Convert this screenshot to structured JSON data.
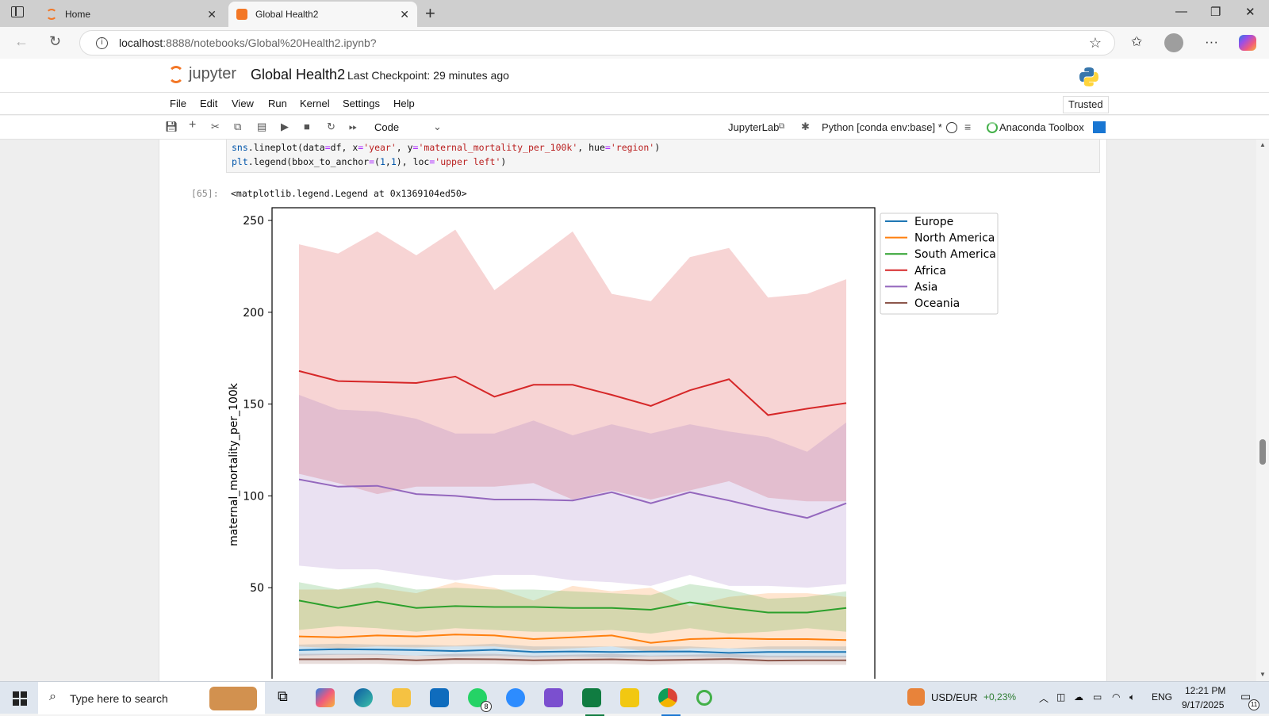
{
  "browser": {
    "tabs": [
      {
        "title": "Home",
        "active": false
      },
      {
        "title": "Global Health2",
        "active": true
      }
    ],
    "url_host": "localhost",
    "url_rest": ":8888/notebooks/Global%20Health2.ipynb?"
  },
  "jupyter": {
    "logo_text": "jupyter",
    "notebook_title": "Global Health2",
    "checkpoint": "Last Checkpoint: 29 minutes ago",
    "menu": [
      "File",
      "Edit",
      "View",
      "Run",
      "Kernel",
      "Settings",
      "Help"
    ],
    "trusted": "Trusted",
    "cell_type": "Code",
    "jupyterlab_link": "JupyterLab",
    "kernel": "Python [conda env:base] *",
    "anaconda": "Anaconda Toolbox"
  },
  "cell": {
    "code_lines": [
      "sns.lineplot(data=df, x='year', y='maternal_mortality_per_100k', hue='region')",
      "plt.legend(bbox_to_anchor=(1,1), loc='upper left')"
    ],
    "out_prompt": "[65]:",
    "output_text": "<matplotlib.legend.Legend at 0x1369104ed50>"
  },
  "chart_data": {
    "type": "line",
    "xlabel": "",
    "ylabel": "maternal_mortality_per_100k",
    "yticks": [
      50,
      100,
      150,
      200,
      250
    ],
    "ylim": [
      10,
      255
    ],
    "x": [
      0,
      1,
      2,
      3,
      4,
      5,
      6,
      7,
      8,
      9,
      10,
      11,
      12,
      13,
      14
    ],
    "legend_position": "upper-left outside right",
    "series": [
      {
        "name": "Europe",
        "color": "#1f77b4",
        "values": [
          16,
          16.5,
          16.3,
          16,
          15.5,
          16.2,
          15,
          15.3,
          15,
          15.2,
          15.3,
          14.5,
          15,
          15,
          15
        ],
        "ci_low": [
          13,
          13.5,
          13.5,
          13,
          12.5,
          13,
          12,
          12.5,
          12,
          12.5,
          12.5,
          12,
          12,
          12,
          12
        ],
        "ci_high": [
          19,
          19.5,
          19,
          19,
          18.5,
          19.5,
          18,
          18,
          18,
          18,
          18,
          17,
          18,
          18,
          18
        ]
      },
      {
        "name": "North America",
        "color": "#ff7f0e",
        "values": [
          23.5,
          23,
          24,
          23.5,
          24.5,
          24,
          22,
          23,
          24,
          20,
          22,
          22.5,
          22,
          22,
          21.5
        ],
        "ci_low": [
          18,
          17,
          18,
          17.5,
          18,
          18,
          16,
          17,
          18,
          15,
          17,
          17,
          16.5,
          16.5,
          16
        ],
        "ci_high": [
          49,
          49,
          50,
          47,
          53,
          50,
          43,
          51,
          48,
          50,
          40,
          45,
          47,
          47,
          45
        ]
      },
      {
        "name": "South America",
        "color": "#2ca02c",
        "values": [
          43,
          39,
          42.5,
          39,
          40,
          39.5,
          39.5,
          39,
          39,
          38,
          42,
          39,
          36.5,
          36.5,
          39
        ],
        "ci_low": [
          27,
          29,
          28,
          26,
          28,
          27,
          26,
          26,
          27,
          25,
          28,
          25,
          26,
          28,
          26
        ],
        "ci_high": [
          53,
          49,
          53,
          49,
          50,
          49,
          49,
          48,
          47,
          46,
          52,
          49,
          44,
          45,
          48
        ]
      },
      {
        "name": "Africa",
        "color": "#d62728",
        "values": [
          168,
          162.5,
          162,
          161.5,
          165,
          154,
          160.5,
          160.5,
          155,
          149,
          157.5,
          163.5,
          144,
          147.5,
          150.5
        ],
        "ci_low": [
          112,
          107,
          101,
          105,
          105,
          105,
          107,
          98,
          103,
          98,
          103,
          108,
          99,
          97,
          97
        ],
        "ci_high": [
          237,
          232,
          244,
          231,
          245,
          212,
          228,
          244,
          210,
          206,
          230,
          235,
          208,
          210,
          218
        ]
      },
      {
        "name": "Asia",
        "color": "#9467bd",
        "values": [
          109,
          105,
          105.5,
          101,
          100,
          98,
          98,
          97.5,
          102,
          96,
          102,
          97.5,
          92.5,
          88,
          96
        ],
        "ci_low": [
          62,
          60,
          60,
          57,
          54,
          57,
          57,
          54,
          53,
          51,
          57,
          51,
          51,
          50,
          52
        ],
        "ci_high": [
          155,
          147,
          146,
          142,
          134,
          134,
          141,
          133,
          139,
          134,
          139,
          135,
          132,
          124,
          140
        ]
      },
      {
        "name": "Oceania",
        "color": "#8c564b",
        "values": [
          11,
          11,
          11.2,
          10.5,
          11.2,
          11,
          10.5,
          10.8,
          11,
          10.5,
          10.8,
          11.2,
          10.3,
          10.5,
          10.5
        ],
        "ci_low": [
          8.5,
          8.5,
          8.5,
          8,
          8.5,
          8.5,
          8,
          8.5,
          8.5,
          8,
          8.5,
          8.5,
          8,
          8,
          8
        ],
        "ci_high": [
          14,
          14,
          14,
          13,
          14,
          14,
          13,
          13.5,
          14,
          13,
          13.5,
          14,
          13,
          13,
          13
        ]
      }
    ]
  },
  "taskbar": {
    "search_placeholder": "Type here to search",
    "currency": "USD/EUR",
    "currency_change": "+0,23%",
    "lang": "ENG",
    "time": "12:21 PM",
    "date": "9/17/2025",
    "notif_count": "11",
    "whatsapp_badge": "8"
  },
  "colors": {
    "jupyter_orange": "#f37726",
    "accent_blue": "#1976d2"
  }
}
